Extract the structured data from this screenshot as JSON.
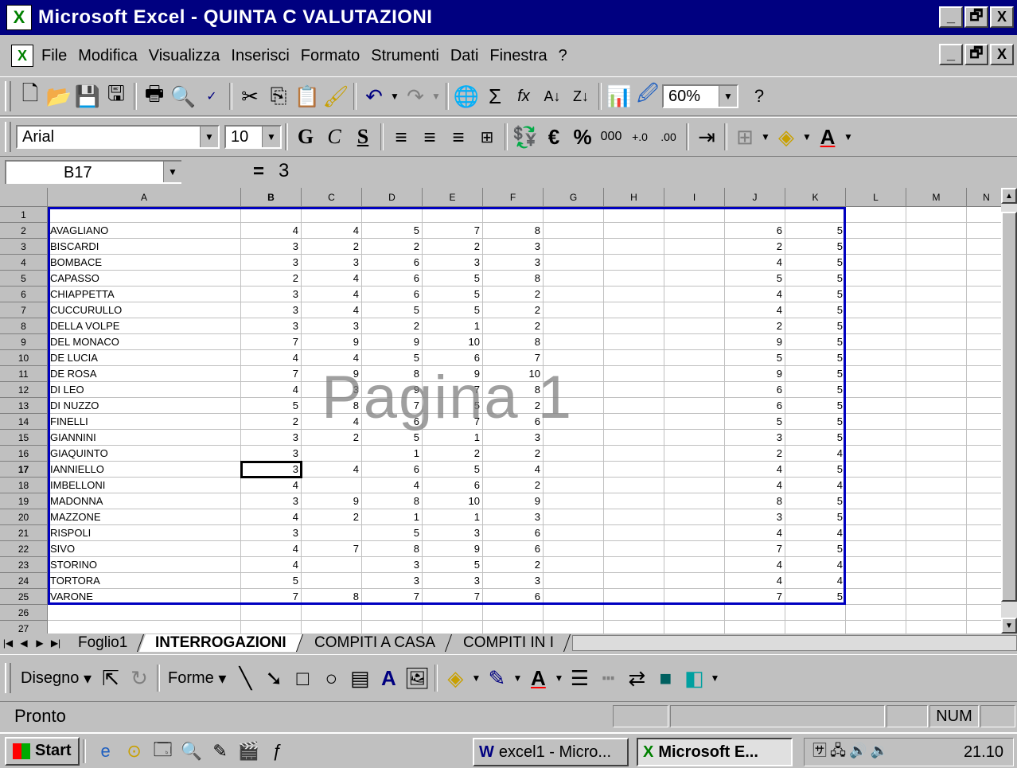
{
  "window": {
    "title": "Microsoft Excel - QUINTA C VALUTAZIONI",
    "min": "_",
    "max": "🗗",
    "close": "X"
  },
  "menu": [
    "File",
    "Modifica",
    "Visualizza",
    "Inserisci",
    "Formato",
    "Strumenti",
    "Dati",
    "Finestra",
    "?"
  ],
  "toolbar": {
    "zoom": "60%",
    "font": "Arial",
    "size": "10",
    "bold": "G",
    "italic": "C",
    "underline": "S",
    "euro": "€",
    "percent": "%",
    "thousands": "000",
    "sigma": "Σ",
    "fx": "fx"
  },
  "formula": {
    "cell_ref": "B17",
    "eq": "=",
    "value": "3"
  },
  "columns": [
    "A",
    "B",
    "C",
    "D",
    "E",
    "F",
    "G",
    "H",
    "I",
    "J",
    "K",
    "L",
    "M",
    "N"
  ],
  "rows": [
    {
      "n": "1",
      "name": "",
      "v": [
        "",
        "",
        "",
        "",
        "",
        "",
        "",
        "",
        "",
        ""
      ]
    },
    {
      "n": "2",
      "name": "AVAGLIANO",
      "v": [
        "4",
        "4",
        "5",
        "7",
        "8",
        "",
        "",
        "",
        "6",
        "5"
      ]
    },
    {
      "n": "3",
      "name": "BISCARDI",
      "v": [
        "3",
        "2",
        "2",
        "2",
        "3",
        "",
        "",
        "",
        "2",
        "5"
      ]
    },
    {
      "n": "4",
      "name": "BOMBACE",
      "v": [
        "3",
        "3",
        "6",
        "3",
        "3",
        "",
        "",
        "",
        "4",
        "5"
      ]
    },
    {
      "n": "5",
      "name": "CAPASSO",
      "v": [
        "2",
        "4",
        "6",
        "5",
        "8",
        "",
        "",
        "",
        "5",
        "5"
      ]
    },
    {
      "n": "6",
      "name": "CHIAPPETTA",
      "v": [
        "3",
        "4",
        "6",
        "5",
        "2",
        "",
        "",
        "",
        "4",
        "5"
      ]
    },
    {
      "n": "7",
      "name": "CUCCURULLO",
      "v": [
        "3",
        "4",
        "5",
        "5",
        "2",
        "",
        "",
        "",
        "4",
        "5"
      ]
    },
    {
      "n": "8",
      "name": "DELLA VOLPE",
      "v": [
        "3",
        "3",
        "2",
        "1",
        "2",
        "",
        "",
        "",
        "2",
        "5"
      ]
    },
    {
      "n": "9",
      "name": "DEL MONACO",
      "v": [
        "7",
        "9",
        "9",
        "10",
        "8",
        "",
        "",
        "",
        "9",
        "5"
      ]
    },
    {
      "n": "10",
      "name": "DE LUCIA",
      "v": [
        "4",
        "4",
        "5",
        "6",
        "7",
        "",
        "",
        "",
        "5",
        "5"
      ]
    },
    {
      "n": "11",
      "name": "DE ROSA",
      "v": [
        "7",
        "9",
        "8",
        "9",
        "10",
        "",
        "",
        "",
        "9",
        "5"
      ]
    },
    {
      "n": "12",
      "name": "DI LEO",
      "v": [
        "4",
        "3",
        "9",
        "7",
        "8",
        "",
        "",
        "",
        "6",
        "5"
      ]
    },
    {
      "n": "13",
      "name": "DI NUZZO",
      "v": [
        "5",
        "8",
        "7",
        "5",
        "2",
        "",
        "",
        "",
        "6",
        "5"
      ]
    },
    {
      "n": "14",
      "name": "FINELLI",
      "v": [
        "2",
        "4",
        "6",
        "7",
        "6",
        "",
        "",
        "",
        "5",
        "5"
      ]
    },
    {
      "n": "15",
      "name": "GIANNINI",
      "v": [
        "3",
        "2",
        "5",
        "1",
        "3",
        "",
        "",
        "",
        "3",
        "5"
      ]
    },
    {
      "n": "16",
      "name": "GIAQUINTO",
      "v": [
        "3",
        "",
        "1",
        "2",
        "2",
        "",
        "",
        "",
        "2",
        "4"
      ]
    },
    {
      "n": "17",
      "name": "IANNIELLO",
      "v": [
        "3",
        "4",
        "6",
        "5",
        "4",
        "",
        "",
        "",
        "4",
        "5"
      ]
    },
    {
      "n": "18",
      "name": "IMBELLONI",
      "v": [
        "4",
        "",
        "4",
        "6",
        "2",
        "",
        "",
        "",
        "4",
        "4"
      ]
    },
    {
      "n": "19",
      "name": "MADONNA",
      "v": [
        "3",
        "9",
        "8",
        "10",
        "9",
        "",
        "",
        "",
        "8",
        "5"
      ]
    },
    {
      "n": "20",
      "name": "MAZZONE",
      "v": [
        "4",
        "2",
        "1",
        "1",
        "3",
        "",
        "",
        "",
        "3",
        "5"
      ]
    },
    {
      "n": "21",
      "name": "RISPOLI",
      "v": [
        "3",
        "",
        "5",
        "3",
        "6",
        "",
        "",
        "",
        "4",
        "4"
      ]
    },
    {
      "n": "22",
      "name": "SIVO",
      "v": [
        "4",
        "7",
        "8",
        "9",
        "6",
        "",
        "",
        "",
        "7",
        "5"
      ]
    },
    {
      "n": "23",
      "name": "STORINO",
      "v": [
        "4",
        "",
        "3",
        "5",
        "2",
        "",
        "",
        "",
        "4",
        "4"
      ]
    },
    {
      "n": "24",
      "name": "TORTORA",
      "v": [
        "5",
        "",
        "3",
        "3",
        "3",
        "",
        "",
        "",
        "4",
        "4"
      ]
    },
    {
      "n": "25",
      "name": "VARONE",
      "v": [
        "7",
        "8",
        "7",
        "7",
        "6",
        "",
        "",
        "",
        "7",
        "5"
      ]
    },
    {
      "n": "26",
      "name": "",
      "v": [
        "",
        "",
        "",
        "",
        "",
        "",
        "",
        "",
        "",
        ""
      ]
    },
    {
      "n": "27",
      "name": "",
      "v": [
        "",
        "",
        "",
        "",
        "",
        "",
        "",
        "",
        "",
        ""
      ]
    }
  ],
  "watermark": "Pagina 1",
  "sheets": [
    "Foglio1",
    "INTERROGAZIONI",
    "COMPITI A CASA",
    "COMPITI IN I"
  ],
  "draw": {
    "disegno": "Disegno",
    "forme": "Forme"
  },
  "status": {
    "ready": "Pronto",
    "num": "NUM"
  },
  "taskbar": {
    "start": "Start",
    "task1": "excel1 - Micro...",
    "task2": "Microsoft E...",
    "clock": "21.10"
  }
}
